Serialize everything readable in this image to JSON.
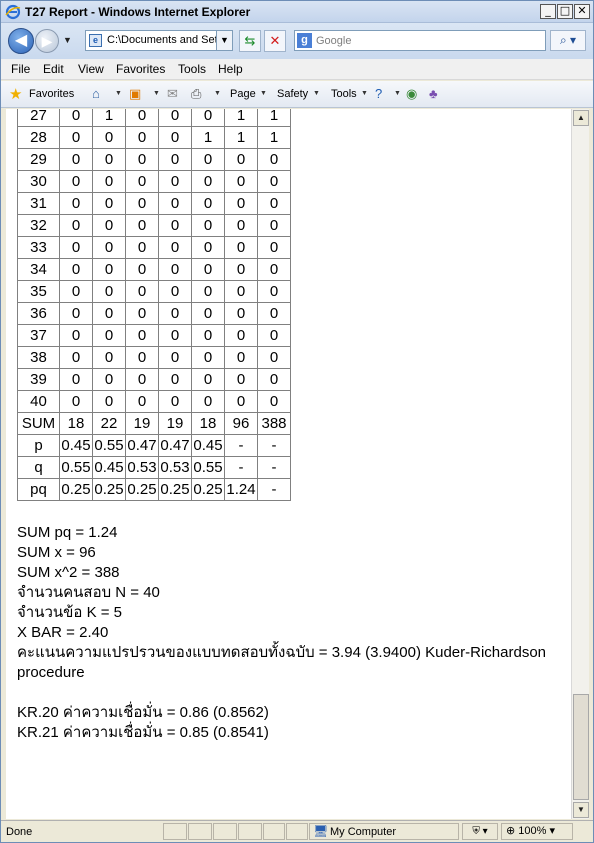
{
  "window": {
    "title": "T27 Report - Windows Internet Explorer"
  },
  "nav": {
    "back_glyph": "◀",
    "forward_glyph": "▶",
    "address": "C:\\Documents and Set",
    "search_placeholder": "Google",
    "search_logo": "g"
  },
  "menu": [
    "File",
    "Edit",
    "View",
    "Favorites",
    "Tools",
    "Help"
  ],
  "favbar": {
    "favorites": "Favorites",
    "page": "Page",
    "safety": "Safety",
    "tools": "Tools"
  },
  "table": {
    "rows": [
      [
        "27",
        "0",
        "1",
        "0",
        "0",
        "0",
        "1",
        "1"
      ],
      [
        "28",
        "0",
        "0",
        "0",
        "0",
        "1",
        "1",
        "1"
      ],
      [
        "29",
        "0",
        "0",
        "0",
        "0",
        "0",
        "0",
        "0"
      ],
      [
        "30",
        "0",
        "0",
        "0",
        "0",
        "0",
        "0",
        "0"
      ],
      [
        "31",
        "0",
        "0",
        "0",
        "0",
        "0",
        "0",
        "0"
      ],
      [
        "32",
        "0",
        "0",
        "0",
        "0",
        "0",
        "0",
        "0"
      ],
      [
        "33",
        "0",
        "0",
        "0",
        "0",
        "0",
        "0",
        "0"
      ],
      [
        "34",
        "0",
        "0",
        "0",
        "0",
        "0",
        "0",
        "0"
      ],
      [
        "35",
        "0",
        "0",
        "0",
        "0",
        "0",
        "0",
        "0"
      ],
      [
        "36",
        "0",
        "0",
        "0",
        "0",
        "0",
        "0",
        "0"
      ],
      [
        "37",
        "0",
        "0",
        "0",
        "0",
        "0",
        "0",
        "0"
      ],
      [
        "38",
        "0",
        "0",
        "0",
        "0",
        "0",
        "0",
        "0"
      ],
      [
        "39",
        "0",
        "0",
        "0",
        "0",
        "0",
        "0",
        "0"
      ],
      [
        "40",
        "0",
        "0",
        "0",
        "0",
        "0",
        "0",
        "0"
      ],
      [
        "SUM",
        "18",
        "22",
        "19",
        "19",
        "18",
        "96",
        "388"
      ],
      [
        "p",
        "0.45",
        "0.55",
        "0.47",
        "0.47",
        "0.45",
        "-",
        "-"
      ],
      [
        "q",
        "0.55",
        "0.45",
        "0.53",
        "0.53",
        "0.55",
        "-",
        "-"
      ],
      [
        "pq",
        "0.25",
        "0.25",
        "0.25",
        "0.25",
        "0.25",
        "1.24",
        "-"
      ]
    ]
  },
  "summary": {
    "sum_pq": "SUM pq = 1.24",
    "sum_x": "SUM x = 96",
    "sum_x2": "SUM x^2 = 388",
    "n": "จำนวนคนสอบ N = 40",
    "k": "จำนวนข้อ K = 5",
    "xbar": "X BAR = 2.40",
    "variance": "คะแนนความแปรปรวนของแบบทดสอบทั้งฉบับ = 3.94 (3.9400) Kuder-Richardson procedure",
    "kr20": "KR.20 ค่าความเชื่อมั่น = 0.86 (0.8562)",
    "kr21": "KR.21 ค่าความเชื่อมั่น = 0.85 (0.8541)"
  },
  "status": {
    "text": "Done",
    "zone": "My Computer",
    "zoom": "100%"
  }
}
